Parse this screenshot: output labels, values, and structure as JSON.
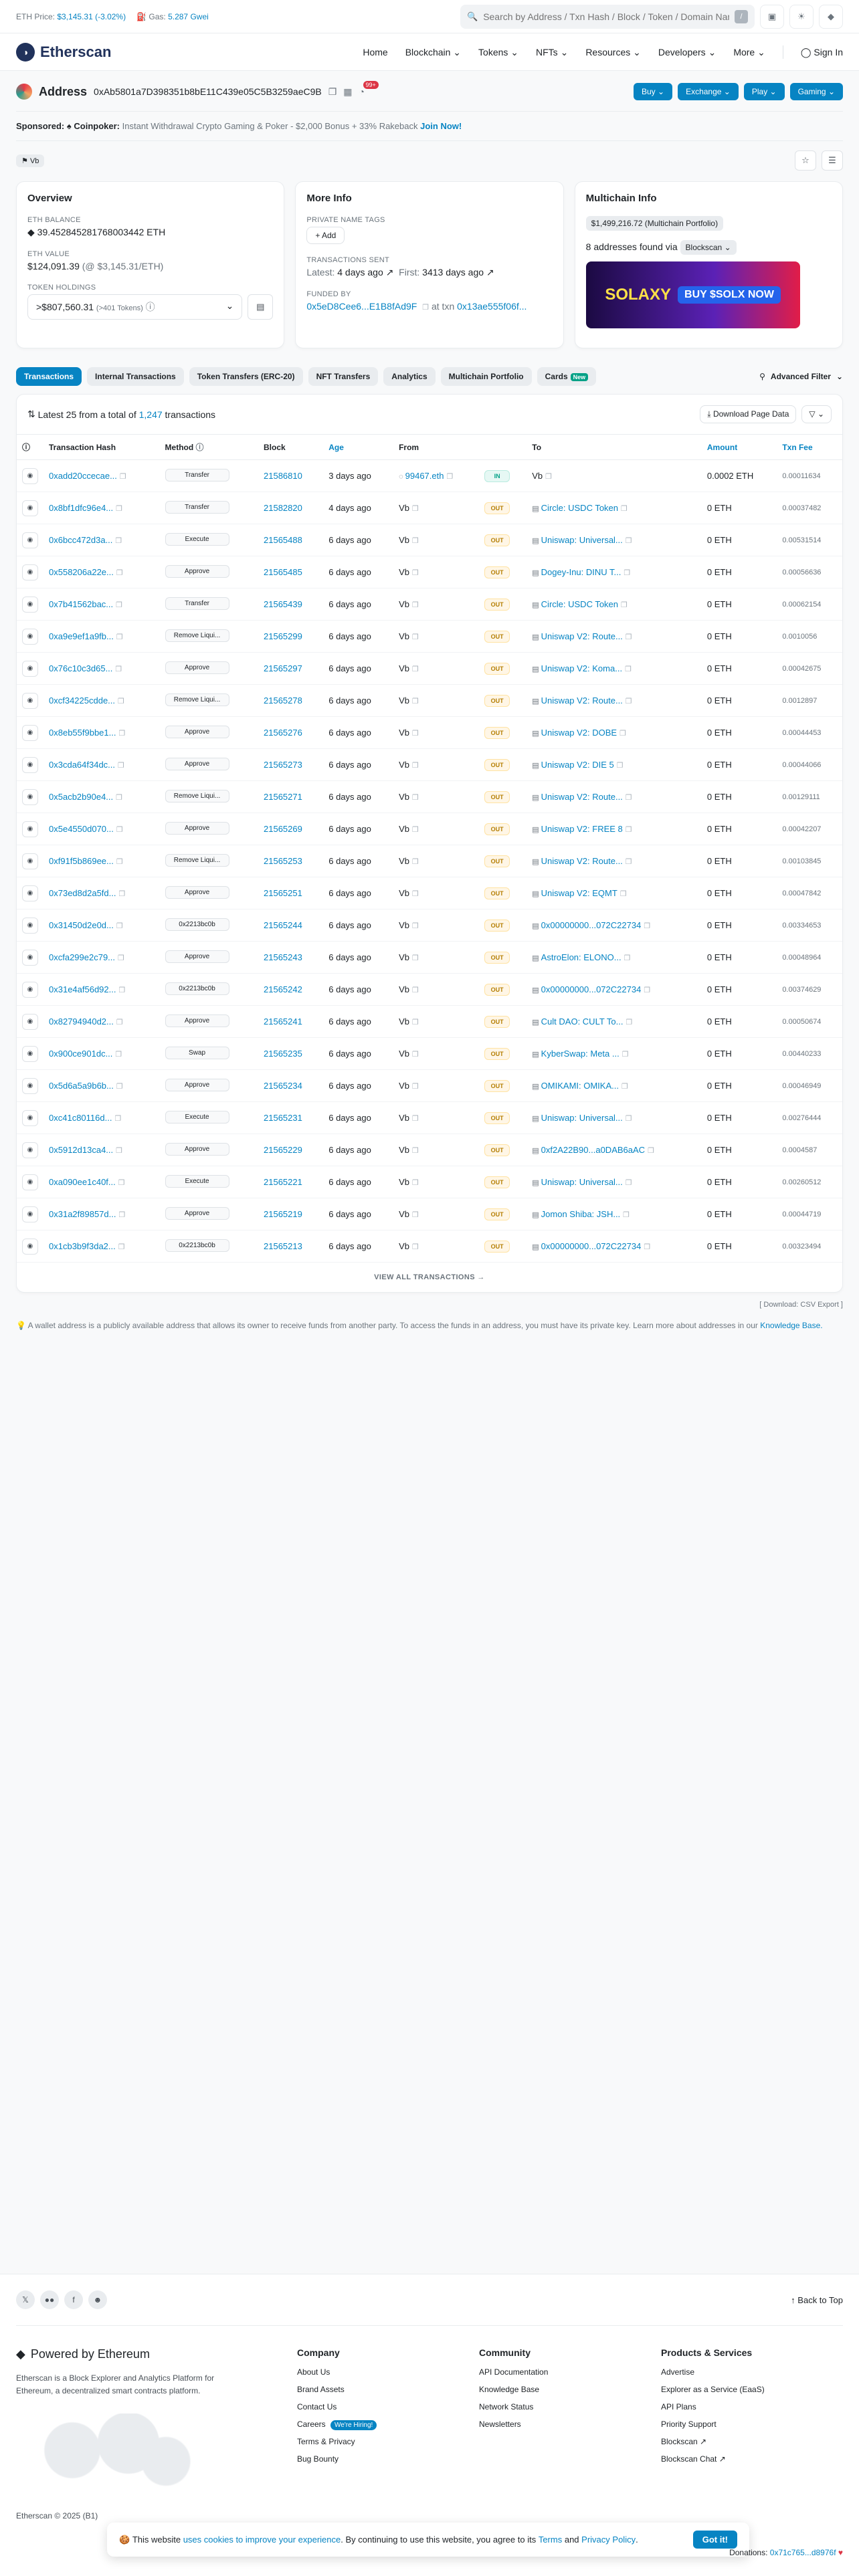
{
  "topbar": {
    "eth_price_label": "ETH Price:",
    "eth_price": "$3,145.31 (-3.02%)",
    "gas_label": "Gas:",
    "gas": "5.287 Gwei",
    "search_placeholder": "Search by Address / Txn Hash / Block / Token / Domain Name",
    "slash": "/"
  },
  "nav": {
    "logo": "Etherscan",
    "items": [
      "Home",
      "Blockchain",
      "Tokens",
      "NFTs",
      "Resources",
      "Developers",
      "More"
    ],
    "signin": "Sign In"
  },
  "address": {
    "title": "Address",
    "hash": "0xAb5801a7D398351b8bE11C439e05C5B3259aeC9B",
    "badge": "99+",
    "buttons": [
      "Buy",
      "Exchange",
      "Play",
      "Gaming"
    ]
  },
  "sponsor": {
    "label": "Sponsored:",
    "name": "Coinpoker:",
    "text": "Instant Withdrawal Crypto Gaming & Poker - $2,000 Bonus + 33% Rakeback",
    "cta": "Join Now!"
  },
  "tag": "Vb",
  "overview": {
    "title": "Overview",
    "eth_balance_label": "ETH BALANCE",
    "eth_balance": "39.452845281768003442 ETH",
    "eth_value_label": "ETH VALUE",
    "eth_value": "$124,091.39",
    "eth_value_rate": "(@ $3,145.31/ETH)",
    "token_holdings_label": "TOKEN HOLDINGS",
    "token_holdings": ">$807,560.31",
    "token_count": "(>401 Tokens)"
  },
  "more_info": {
    "title": "More Info",
    "private_tags_label": "PRIVATE NAME TAGS",
    "add": "+ Add",
    "tx_sent_label": "TRANSACTIONS SENT",
    "latest_label": "Latest:",
    "latest": "4 days ago",
    "first_label": "First:",
    "first": "3413 days ago",
    "funded_by_label": "FUNDED BY",
    "funded_by": "0x5eD8Cee6...E1B8fAd9F",
    "at_txn": "at txn",
    "txn": "0x13ae555f06f..."
  },
  "multichain": {
    "title": "Multichain Info",
    "portfolio": "$1,499,216.72 (Multichain Portfolio)",
    "found": "8 addresses found via",
    "via": "Blockscan",
    "ad_text": "SOLAXY",
    "ad_cta": "BUY $SOLX NOW"
  },
  "tabs": [
    "Transactions",
    "Internal Transactions",
    "Token Transfers (ERC-20)",
    "NFT Transfers",
    "Analytics",
    "Multichain Portfolio",
    "Cards"
  ],
  "tab_new": "New",
  "advanced_filter": "Advanced Filter",
  "summary": {
    "prefix": "Latest 25 from a total of",
    "total": "1,247",
    "suffix": "transactions",
    "download": "Download Page Data"
  },
  "columns": [
    "Transaction Hash",
    "Method",
    "Block",
    "Age",
    "From",
    "",
    "To",
    "Amount",
    "Txn Fee"
  ],
  "rows": [
    {
      "hash": "0xadd20ccecae...",
      "method": "Transfer",
      "block": "21586810",
      "age": "3 days ago",
      "from": "99467.eth",
      "dir": "IN",
      "to": "Vb",
      "amount": "0.0002 ETH",
      "fee": "0.00011634"
    },
    {
      "hash": "0x8bf1dfc96e4...",
      "method": "Transfer",
      "block": "21582820",
      "age": "4 days ago",
      "from": "Vb",
      "dir": "OUT",
      "to": "Circle: USDC Token",
      "amount": "0 ETH",
      "fee": "0.00037482"
    },
    {
      "hash": "0x6bcc472d3a...",
      "method": "Execute",
      "block": "21565488",
      "age": "6 days ago",
      "from": "Vb",
      "dir": "OUT",
      "to": "Uniswap: Universal...",
      "amount": "0 ETH",
      "fee": "0.00531514"
    },
    {
      "hash": "0x558206a22e...",
      "method": "Approve",
      "block": "21565485",
      "age": "6 days ago",
      "from": "Vb",
      "dir": "OUT",
      "to": "Dogey-Inu: DINU T...",
      "amount": "0 ETH",
      "fee": "0.00056636"
    },
    {
      "hash": "0x7b41562bac...",
      "method": "Transfer",
      "block": "21565439",
      "age": "6 days ago",
      "from": "Vb",
      "dir": "OUT",
      "to": "Circle: USDC Token",
      "amount": "0 ETH",
      "fee": "0.00062154"
    },
    {
      "hash": "0xa9e9ef1a9fb...",
      "method": "Remove Liqui...",
      "block": "21565299",
      "age": "6 days ago",
      "from": "Vb",
      "dir": "OUT",
      "to": "Uniswap V2: Route...",
      "amount": "0 ETH",
      "fee": "0.0010056"
    },
    {
      "hash": "0x76c10c3d65...",
      "method": "Approve",
      "block": "21565297",
      "age": "6 days ago",
      "from": "Vb",
      "dir": "OUT",
      "to": "Uniswap V2: Koma...",
      "amount": "0 ETH",
      "fee": "0.00042675"
    },
    {
      "hash": "0xcf34225cdde...",
      "method": "Remove Liqui...",
      "block": "21565278",
      "age": "6 days ago",
      "from": "Vb",
      "dir": "OUT",
      "to": "Uniswap V2: Route...",
      "amount": "0 ETH",
      "fee": "0.0012897"
    },
    {
      "hash": "0x8eb55f9bbe1...",
      "method": "Approve",
      "block": "21565276",
      "age": "6 days ago",
      "from": "Vb",
      "dir": "OUT",
      "to": "Uniswap V2: DOBE",
      "amount": "0 ETH",
      "fee": "0.00044453"
    },
    {
      "hash": "0x3cda64f34dc...",
      "method": "Approve",
      "block": "21565273",
      "age": "6 days ago",
      "from": "Vb",
      "dir": "OUT",
      "to": "Uniswap V2: DIE 5",
      "amount": "0 ETH",
      "fee": "0.00044066"
    },
    {
      "hash": "0x5acb2b90e4...",
      "method": "Remove Liqui...",
      "block": "21565271",
      "age": "6 days ago",
      "from": "Vb",
      "dir": "OUT",
      "to": "Uniswap V2: Route...",
      "amount": "0 ETH",
      "fee": "0.00129111"
    },
    {
      "hash": "0x5e4550d070...",
      "method": "Approve",
      "block": "21565269",
      "age": "6 days ago",
      "from": "Vb",
      "dir": "OUT",
      "to": "Uniswap V2: FREE 8",
      "amount": "0 ETH",
      "fee": "0.00042207"
    },
    {
      "hash": "0xf91f5b869ee...",
      "method": "Remove Liqui...",
      "block": "21565253",
      "age": "6 days ago",
      "from": "Vb",
      "dir": "OUT",
      "to": "Uniswap V2: Route...",
      "amount": "0 ETH",
      "fee": "0.00103845"
    },
    {
      "hash": "0x73ed8d2a5fd...",
      "method": "Approve",
      "block": "21565251",
      "age": "6 days ago",
      "from": "Vb",
      "dir": "OUT",
      "to": "Uniswap V2: EQMT",
      "amount": "0 ETH",
      "fee": "0.00047842"
    },
    {
      "hash": "0x31450d2e0d...",
      "method": "0x2213bc0b",
      "block": "21565244",
      "age": "6 days ago",
      "from": "Vb",
      "dir": "OUT",
      "to": "0x00000000...072C22734",
      "amount": "0 ETH",
      "fee": "0.00334653"
    },
    {
      "hash": "0xcfa299e2c79...",
      "method": "Approve",
      "block": "21565243",
      "age": "6 days ago",
      "from": "Vb",
      "dir": "OUT",
      "to": "AstroElon: ELONO...",
      "amount": "0 ETH",
      "fee": "0.00048964"
    },
    {
      "hash": "0x31e4af56d92...",
      "method": "0x2213bc0b",
      "block": "21565242",
      "age": "6 days ago",
      "from": "Vb",
      "dir": "OUT",
      "to": "0x00000000...072C22734",
      "amount": "0 ETH",
      "fee": "0.00374629"
    },
    {
      "hash": "0x82794940d2...",
      "method": "Approve",
      "block": "21565241",
      "age": "6 days ago",
      "from": "Vb",
      "dir": "OUT",
      "to": "Cult DAO: CULT To...",
      "amount": "0 ETH",
      "fee": "0.00050674"
    },
    {
      "hash": "0x900ce901dc...",
      "method": "Swap",
      "block": "21565235",
      "age": "6 days ago",
      "from": "Vb",
      "dir": "OUT",
      "to": "KyberSwap: Meta ...",
      "amount": "0 ETH",
      "fee": "0.00440233"
    },
    {
      "hash": "0x5d6a5a9b6b...",
      "method": "Approve",
      "block": "21565234",
      "age": "6 days ago",
      "from": "Vb",
      "dir": "OUT",
      "to": "OMIKAMI: OMIKA...",
      "amount": "0 ETH",
      "fee": "0.00046949"
    },
    {
      "hash": "0xc41c80116d...",
      "method": "Execute",
      "block": "21565231",
      "age": "6 days ago",
      "from": "Vb",
      "dir": "OUT",
      "to": "Uniswap: Universal...",
      "amount": "0 ETH",
      "fee": "0.00276444"
    },
    {
      "hash": "0x5912d13ca4...",
      "method": "Approve",
      "block": "21565229",
      "age": "6 days ago",
      "from": "Vb",
      "dir": "OUT",
      "to": "0xf2A22B90...a0DAB6aAC",
      "amount": "0 ETH",
      "fee": "0.0004587"
    },
    {
      "hash": "0xa090ee1c40f...",
      "method": "Execute",
      "block": "21565221",
      "age": "6 days ago",
      "from": "Vb",
      "dir": "OUT",
      "to": "Uniswap: Universal...",
      "amount": "0 ETH",
      "fee": "0.00260512"
    },
    {
      "hash": "0x31a2f89857d...",
      "method": "Approve",
      "block": "21565219",
      "age": "6 days ago",
      "from": "Vb",
      "dir": "OUT",
      "to": "Jomon Shiba: JSH...",
      "amount": "0 ETH",
      "fee": "0.00044719"
    },
    {
      "hash": "0x1cb3b9f3da2...",
      "method": "0x2213bc0b",
      "block": "21565213",
      "age": "6 days ago",
      "from": "Vb",
      "dir": "OUT",
      "to": "0x00000000...072C22734",
      "amount": "0 ETH",
      "fee": "0.00323494"
    }
  ],
  "view_all": "VIEW ALL TRANSACTIONS",
  "download_row": "[ Download: CSV Export ]",
  "note": {
    "text": "A wallet address is a publicly available address that allows its owner to receive funds from another party. To access the funds in an address, you must have its private key. Learn more about addresses in our",
    "link": "Knowledge Base."
  },
  "footer": {
    "back_to_top": "Back to Top",
    "powered": "Powered by Ethereum",
    "desc": "Etherscan is a Block Explorer and Analytics Platform for Ethereum, a decentralized smart contracts platform.",
    "company_title": "Company",
    "company": [
      "About Us",
      "Brand Assets",
      "Contact Us",
      "Careers",
      "Terms & Privacy",
      "Bug Bounty"
    ],
    "hiring": "We're Hiring!",
    "community_title": "Community",
    "community": [
      "API Documentation",
      "Knowledge Base",
      "Network Status",
      "Newsletters"
    ],
    "products_title": "Products & Services",
    "products": [
      "Advertise",
      "Explorer as a Service (EaaS)",
      "API Plans",
      "Priority Support",
      "Blockscan",
      "Blockscan Chat"
    ],
    "copyright": "Etherscan © 2025 (B1)",
    "donations_label": "Donations:",
    "donations": "0x71c765...d8976f"
  },
  "cookie": {
    "pre": "This website",
    "link1": "uses cookies to improve your experience",
    "mid": ". By continuing to use this website, you agree to its",
    "terms": "Terms",
    "and": "and",
    "privacy": "Privacy Policy",
    "ok": "Got it!"
  }
}
